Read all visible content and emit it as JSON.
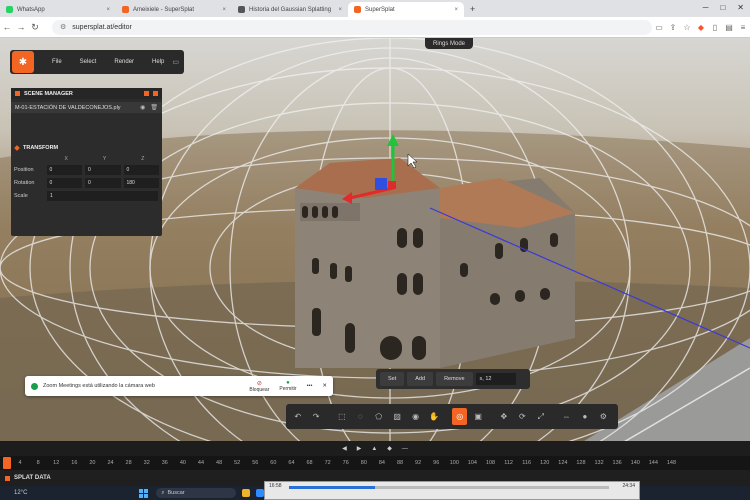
{
  "browser": {
    "tabs": [
      {
        "label": "WhatsApp",
        "color": "#25d366",
        "active": false
      },
      {
        "label": "Ameixiele - SuperSplat",
        "color": "#f26522",
        "active": false
      },
      {
        "label": "Historia del Gaussian Splatting",
        "color": "#555555",
        "active": false
      },
      {
        "label": "SuperSplat",
        "color": "#f26522",
        "active": true
      }
    ],
    "new_tab": "+",
    "url": "supersplat.at/editor"
  },
  "viewport": {
    "mode_pill": "Rings Mode"
  },
  "menu": {
    "logo_icon": "supersplat-logo-icon",
    "items": [
      "File",
      "Select",
      "Render",
      "Help"
    ]
  },
  "scene_manager": {
    "title": "SCENE MANAGER",
    "splat_name": "M-01-ESTACIÓN DE VALDECONEJOS.ply",
    "transform_title": "TRANSFORM",
    "axis_labels": [
      "X",
      "Y",
      "Z"
    ],
    "position_label": "Position",
    "position": [
      "0",
      "0",
      "0"
    ],
    "rotation_label": "Rotation",
    "rotation": [
      "0",
      "0",
      "180"
    ],
    "scale_label": "Scale",
    "scale": "1"
  },
  "zoom_notification": {
    "text": "Zoom Meetings está utilizando la cámara web",
    "block_label": "Bloquear",
    "allow_label": "Permitir",
    "more": "•••",
    "close": "✕"
  },
  "selection_bar": {
    "set_label": "Set",
    "add_label": "Add",
    "remove_label": "Remove",
    "value": "s, 12"
  },
  "timeline": {
    "ticks": [
      "4",
      "8",
      "12",
      "16",
      "20",
      "24",
      "28",
      "32",
      "36",
      "40",
      "44",
      "48",
      "52",
      "56",
      "60",
      "64",
      "68",
      "72",
      "76",
      "80",
      "84",
      "88",
      "92",
      "96",
      "100",
      "104",
      "108",
      "112",
      "116",
      "120",
      "124",
      "128",
      "132",
      "136",
      "140",
      "144",
      "148"
    ]
  },
  "splat_data_label": "SPLAT DATA",
  "taskbar": {
    "weather": "12°C",
    "search_placeholder": "Buscar"
  },
  "video_player": {
    "elapsed": "16:58",
    "remaining": "24:34",
    "progress": 0.27
  }
}
